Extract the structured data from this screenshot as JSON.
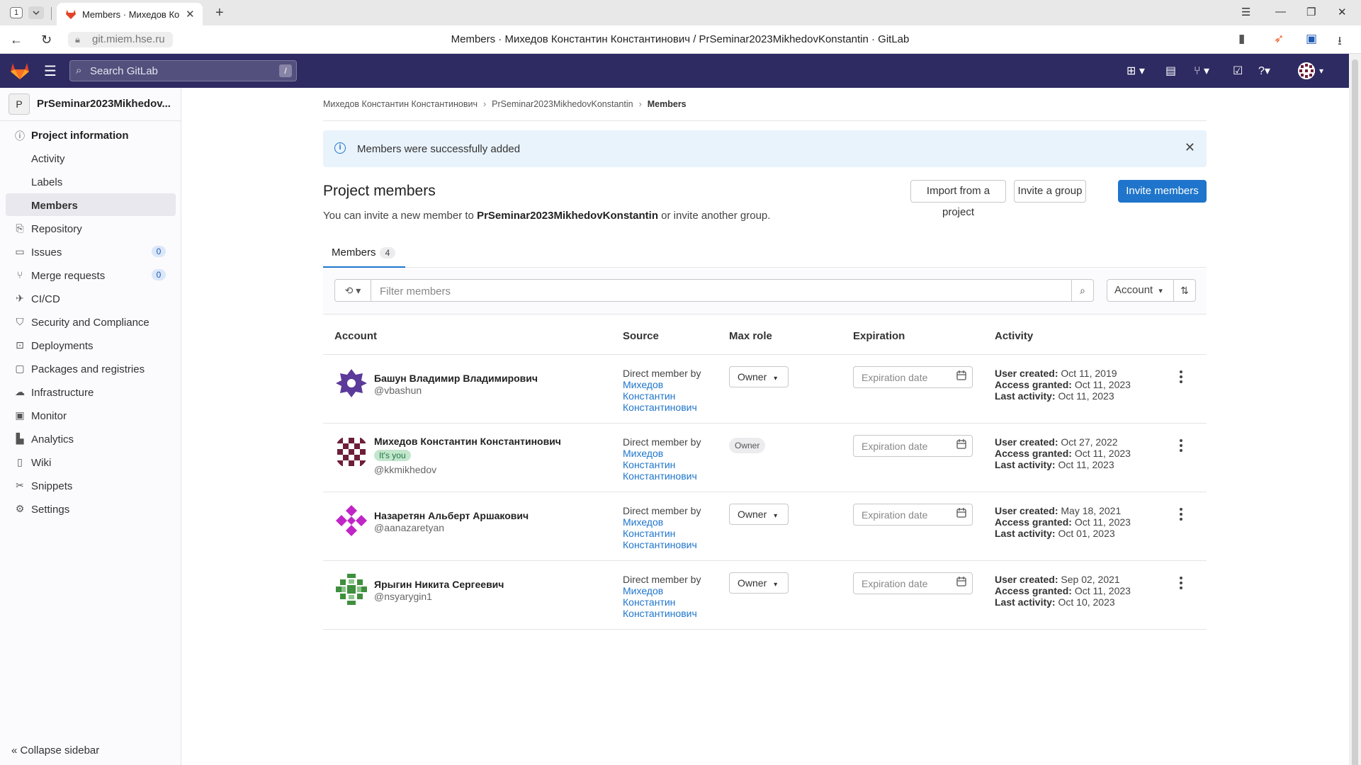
{
  "browser": {
    "tab_count": "1",
    "tab_title": "Members · Михедов Ко",
    "url": "git.miem.hse.ru",
    "page_title": "Members · Михедов Константин Константинович / PrSeminar2023MikhedovKonstantin · GitLab"
  },
  "header": {
    "search_placeholder": "Search GitLab",
    "search_shortcut": "/"
  },
  "sidebar": {
    "project_initial": "P",
    "project_name": "PrSeminar2023Mikhedov...",
    "items": [
      {
        "label": "Project information",
        "icon": "info-icon"
      },
      {
        "label": "Activity"
      },
      {
        "label": "Labels"
      },
      {
        "label": "Members"
      },
      {
        "label": "Repository",
        "icon": "repository-icon"
      },
      {
        "label": "Issues",
        "icon": "issues-icon",
        "count": "0"
      },
      {
        "label": "Merge requests",
        "icon": "merge-request-icon",
        "count": "0"
      },
      {
        "label": "CI/CD",
        "icon": "rocket-icon"
      },
      {
        "label": "Security and Compliance",
        "icon": "shield-icon"
      },
      {
        "label": "Deployments",
        "icon": "deployments-icon"
      },
      {
        "label": "Packages and registries",
        "icon": "package-icon"
      },
      {
        "label": "Infrastructure",
        "icon": "cloud-icon"
      },
      {
        "label": "Monitor",
        "icon": "monitor-icon"
      },
      {
        "label": "Analytics",
        "icon": "chart-icon"
      },
      {
        "label": "Wiki",
        "icon": "book-icon"
      },
      {
        "label": "Snippets",
        "icon": "scissors-icon"
      },
      {
        "label": "Settings",
        "icon": "gear-icon"
      }
    ],
    "collapse_label": "Collapse sidebar"
  },
  "breadcrumbs": {
    "owner": "Михедов Константин Константинович",
    "project": "PrSeminar2023MikhedovKonstantin",
    "current": "Members"
  },
  "alert": {
    "text": "Members were successfully added"
  },
  "page": {
    "title": "Project members",
    "desc_prefix": "You can invite a new member to ",
    "desc_project": "PrSeminar2023MikhedovKonstantin",
    "desc_suffix": " or invite another group.",
    "import_button": "Import from a project",
    "invite_group_button": "Invite a group",
    "invite_members_button": "Invite members"
  },
  "tabs": {
    "members_label": "Members",
    "members_count": "4"
  },
  "filter": {
    "placeholder": "Filter members",
    "sort_label": "Account"
  },
  "table": {
    "columns": [
      "Account",
      "Source",
      "Max role",
      "Expiration",
      "Activity"
    ],
    "expiration_placeholder": "Expiration date",
    "source_prefix": "Direct member by",
    "source_name_lines": [
      "Михедов",
      "Константин",
      "Константинович"
    ],
    "user_created_label": "User created:",
    "access_granted_label": "Access granted:",
    "last_activity_label": "Last activity:",
    "rows": [
      {
        "name": "Башун Владимир Владимирович",
        "username": "@vbashun",
        "role": "Owner",
        "role_editable": true,
        "user_created": "Oct 11, 2019",
        "access_granted": "Oct 11, 2023",
        "last_activity": "Oct 11, 2023"
      },
      {
        "name": "Михедов Константин Константинович",
        "username": "@kkmikhedov",
        "badge": "It's you",
        "role": "Owner",
        "role_editable": false,
        "user_created": "Oct 27, 2022",
        "access_granted": "Oct 11, 2023",
        "last_activity": "Oct 11, 2023"
      },
      {
        "name": "Назаретян Альберт Аршакович",
        "username": "@aanazaretyan",
        "role": "Owner",
        "role_editable": true,
        "user_created": "May 18, 2021",
        "access_granted": "Oct 11, 2023",
        "last_activity": "Oct 01, 2023"
      },
      {
        "name": "Ярыгин Никита Сергеевич",
        "username": "@nsyarygin1",
        "role": "Owner",
        "role_editable": true,
        "user_created": "Sep 02, 2021",
        "access_granted": "Oct 11, 2023",
        "last_activity": "Oct 10, 2023"
      }
    ]
  },
  "colors": {
    "header_bg": "#2e2a62",
    "primary": "#1f75cb",
    "link": "#1f75cb",
    "you_badge_bg": "#c3e6cd",
    "avatar_colors": [
      "#5b3a9a",
      "#6d1f3a",
      "#c026c7",
      "#3f8f3f"
    ]
  }
}
